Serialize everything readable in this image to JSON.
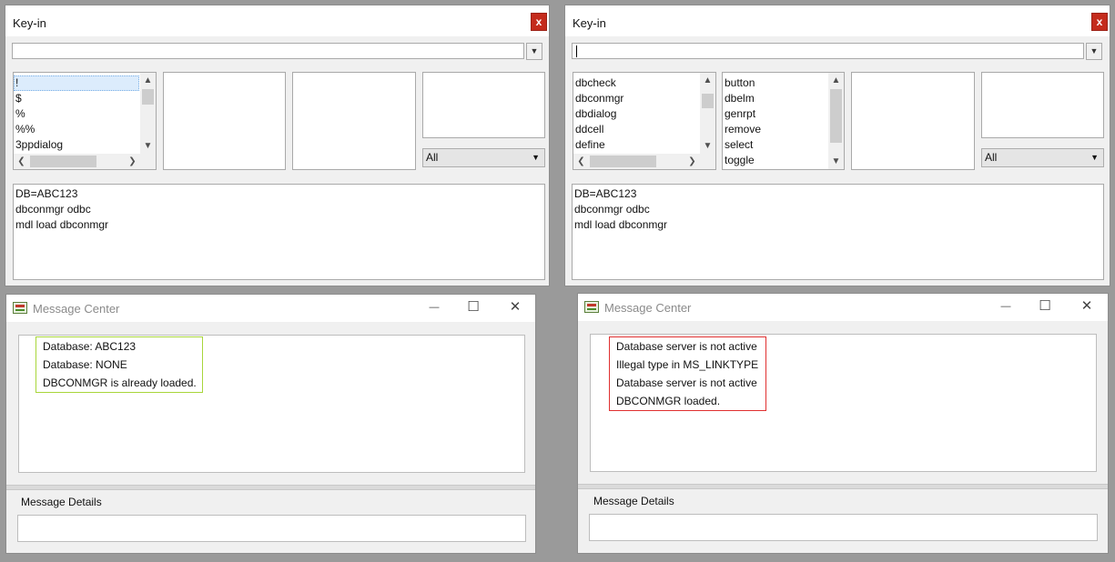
{
  "colors": {
    "close_bg": "#c42b1c",
    "highlight_ok": "#a8d63a",
    "highlight_err": "#e03030",
    "selection": "#dcecfc"
  },
  "keyin_left": {
    "title": "Key-in",
    "close_label": "x",
    "input_value": "",
    "list1": [
      "!",
      "$",
      "%",
      "%%",
      "3ppdialog"
    ],
    "dropdown_value": "All",
    "history": [
      "DB=ABC123",
      "dbconmgr odbc",
      "mdl load dbconmgr"
    ]
  },
  "keyin_right": {
    "title": "Key-in",
    "close_label": "x",
    "input_value": "",
    "list1": [
      "dbcheck",
      "dbconmgr",
      "dbdialog",
      "ddcell",
      "define"
    ],
    "list2": [
      "button",
      "dbelm",
      "genrpt",
      "remove",
      "select",
      "toggle"
    ],
    "dropdown_value": "All",
    "history": [
      "DB=ABC123",
      "dbconmgr odbc",
      "mdl load dbconmgr"
    ]
  },
  "msg_left": {
    "title": "Message Center",
    "messages": [
      "Database: ABC123",
      "Database: NONE",
      "DBCONMGR is already loaded."
    ],
    "details_label": "Message Details"
  },
  "msg_right": {
    "title": "Message Center",
    "messages": [
      "Database server is not active",
      "Illegal type in MS_LINKTYPE",
      "Database server is not active",
      "DBCONMGR loaded."
    ],
    "details_label": "Message Details"
  },
  "icons": {
    "minimize": "—",
    "maximize": "☐",
    "close": "✕",
    "down": "▼",
    "up": "▲",
    "left": "❮",
    "right": "❯"
  }
}
